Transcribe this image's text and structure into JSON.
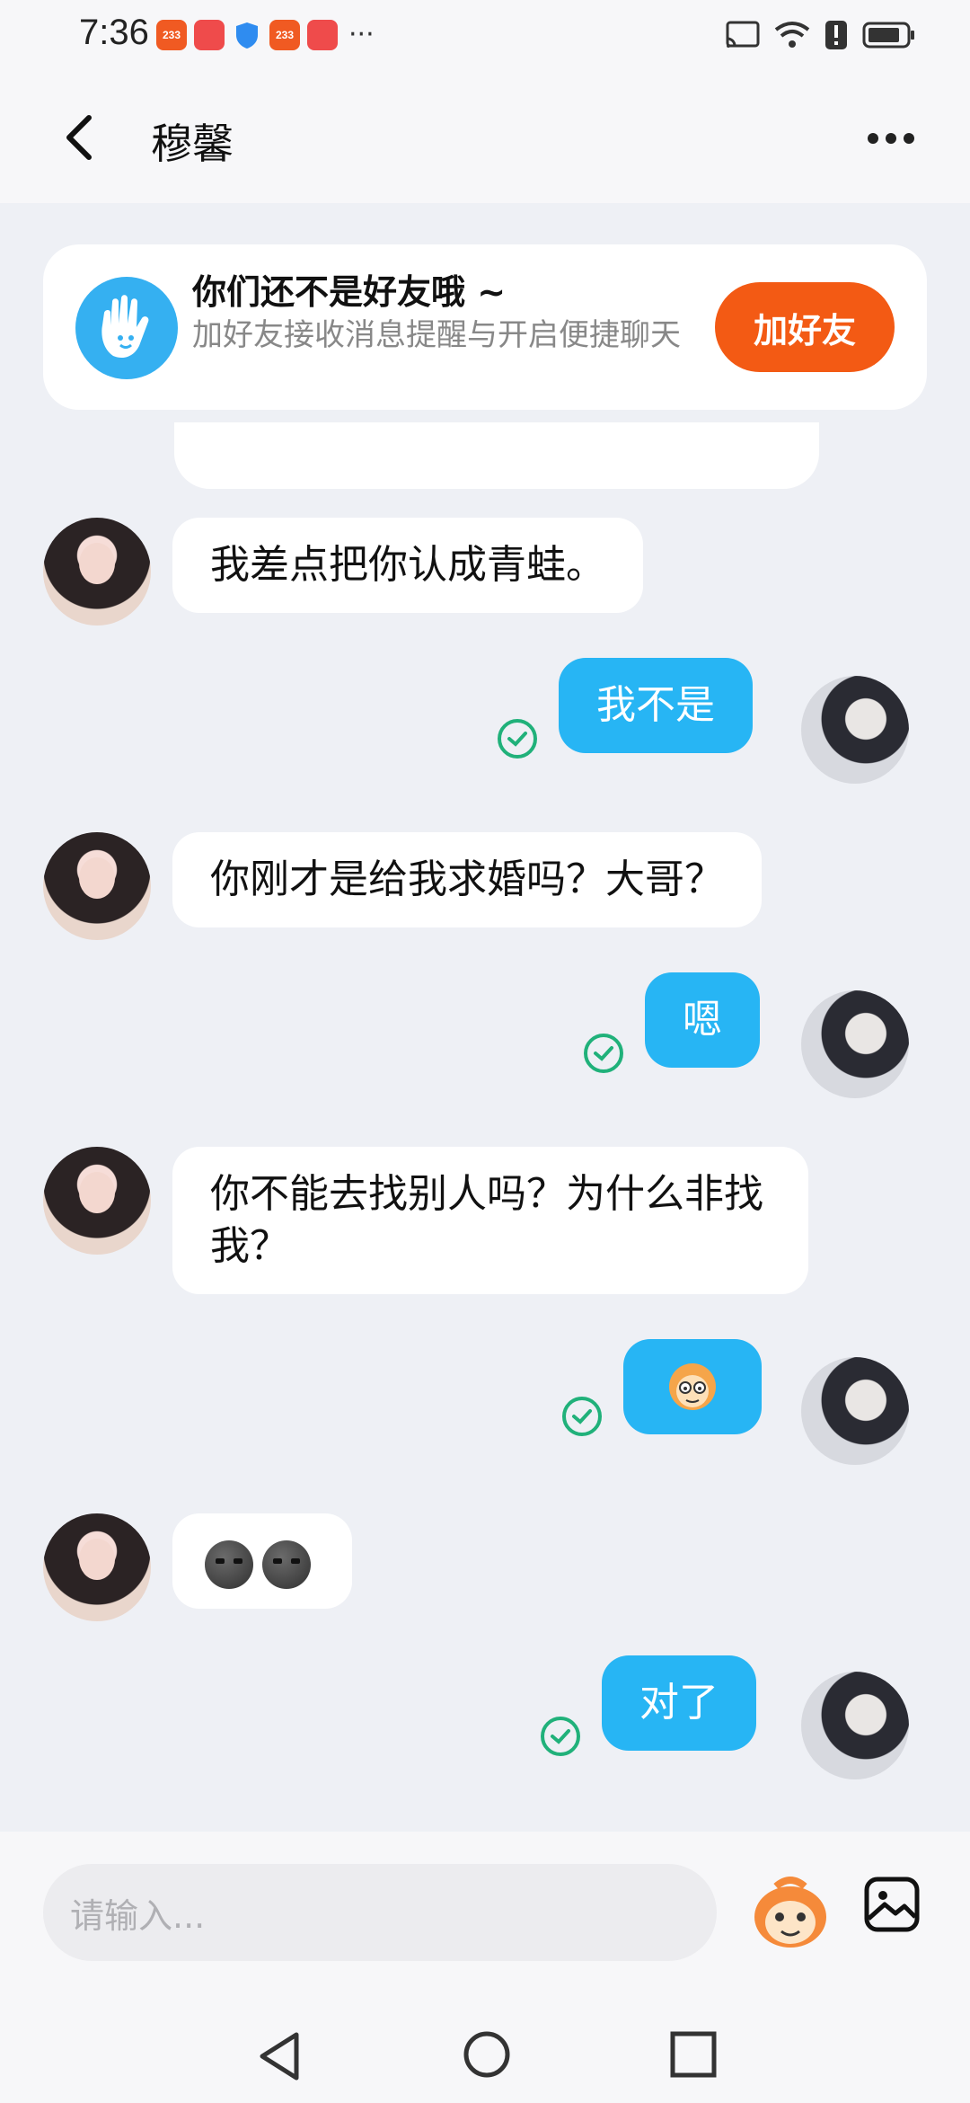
{
  "status_bar": {
    "time": "7:36",
    "app_badges": [
      "233",
      "HUAWEI",
      "shield",
      "233",
      "HUAWEI"
    ],
    "more": "···"
  },
  "header": {
    "title": "穆馨"
  },
  "friend_card": {
    "title": "你们还不是好友哦 ~",
    "subtitle": "加好友接收消息提醒与开启便捷聊天",
    "button": "加好友"
  },
  "messages": [
    {
      "from": "them",
      "text": "我差点把你认成青蛙。"
    },
    {
      "from": "me",
      "text": "我不是"
    },
    {
      "from": "them",
      "text": "你刚才是给我求婚吗？大哥？"
    },
    {
      "from": "me",
      "text": "嗯"
    },
    {
      "from": "them",
      "text": "你不能去找别人吗？为什么非找我？"
    },
    {
      "from": "me",
      "text": "",
      "sticker": "monkey-sticker"
    },
    {
      "from": "them",
      "text": "",
      "emoji": [
        "smirk-emoji",
        "smirk-emoji"
      ]
    },
    {
      "from": "me",
      "text": "对了"
    }
  ],
  "input": {
    "placeholder": "请输入..."
  },
  "colors": {
    "accent_orange": "#f35a14",
    "bubble_blue": "#27b5f4",
    "check_green": "#20b17a",
    "background": "#eef0f5"
  }
}
